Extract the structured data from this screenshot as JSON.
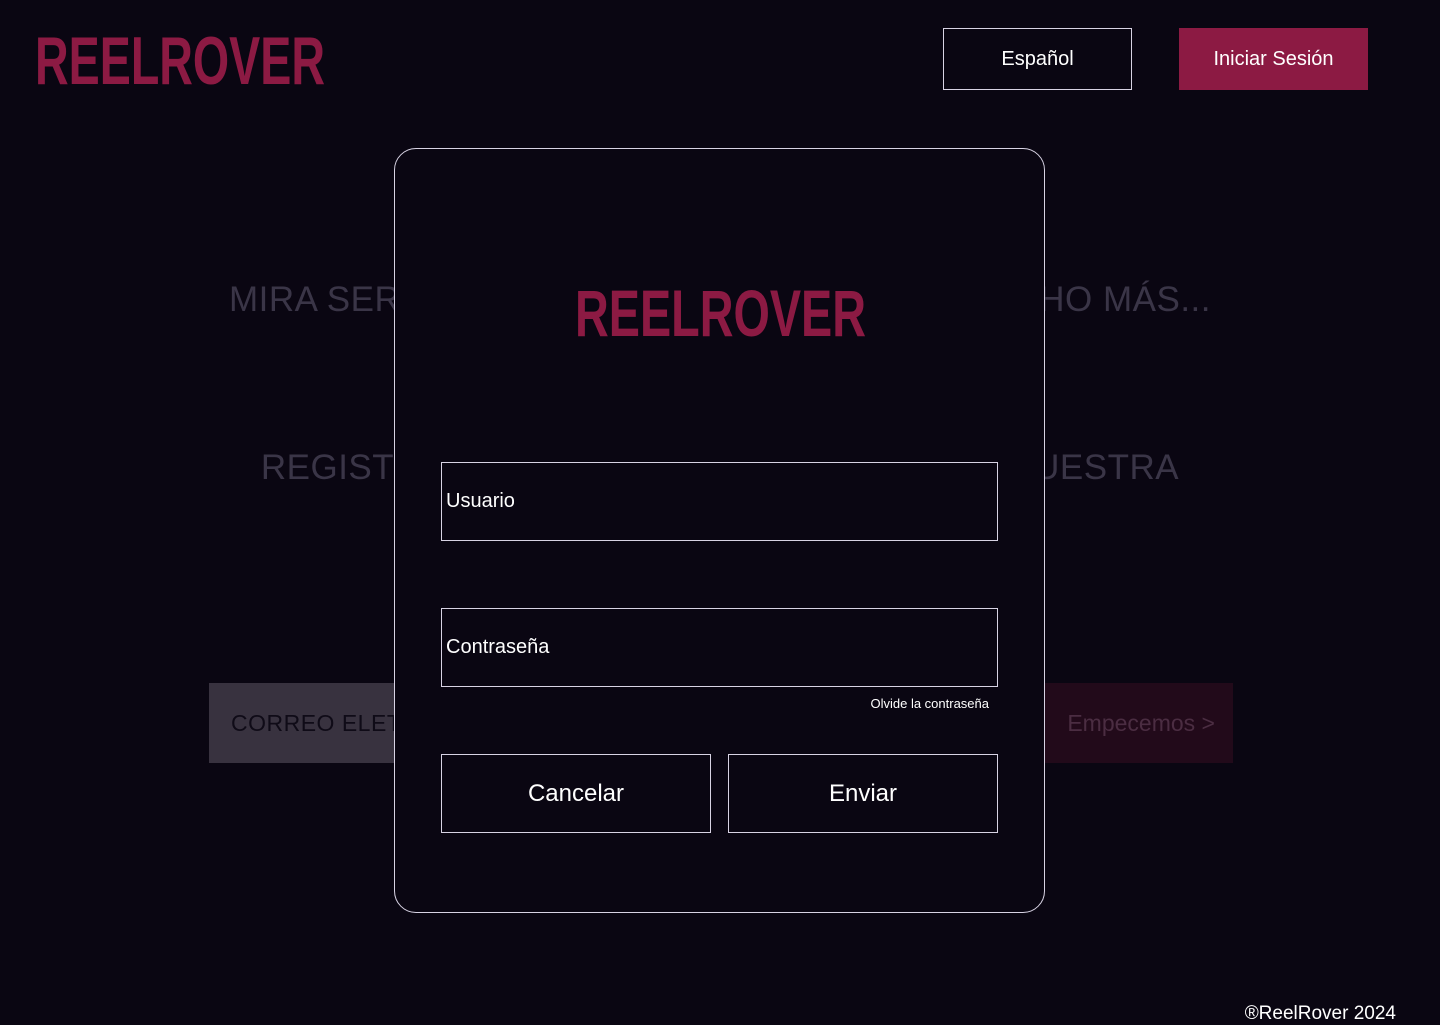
{
  "brand": {
    "logo_text": "REELROVER",
    "color": "#8c1a43"
  },
  "header": {
    "language_label": "Español",
    "login_label": "Iniciar Sesión"
  },
  "hero": {
    "line1_left": "MIRA SERI",
    "line1_right": "CHO MÁS...",
    "line2_left": "REGIST",
    "line2_right": "UESTRA",
    "email_placeholder": "CORREO ELETR",
    "start_label": "Empecemos >"
  },
  "login_modal": {
    "logo_text": "REELROVER",
    "username_placeholder": "Usuario",
    "password_placeholder": "Contraseña",
    "forgot_password": "Olvide la contraseña",
    "cancel_label": "Cancelar",
    "submit_label": "Enviar"
  },
  "footer": {
    "copyright": "®ReelRover 2024"
  },
  "colors": {
    "background": "#0a0612",
    "accent": "#8c1a43",
    "border": "#d8d3e4"
  }
}
